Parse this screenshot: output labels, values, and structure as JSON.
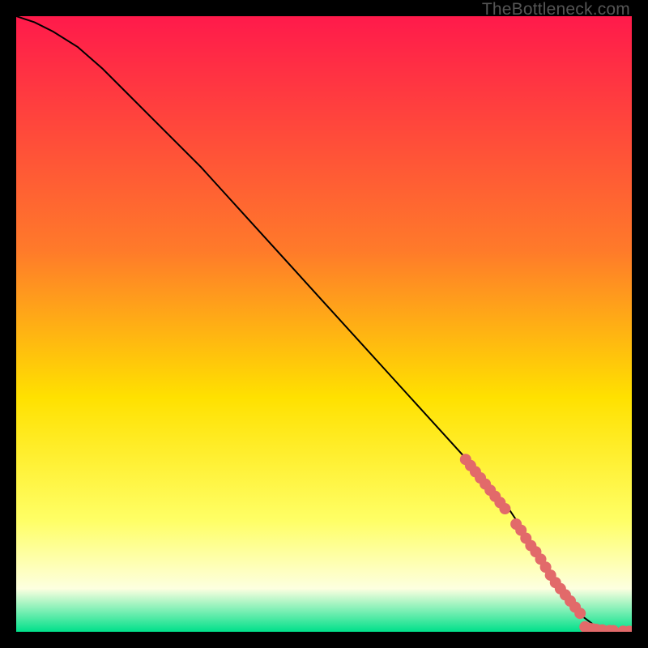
{
  "watermark": "TheBottleneck.com",
  "colors": {
    "gradient_top": "#ff1a4b",
    "gradient_mid1": "#ff7a2a",
    "gradient_mid2": "#ffe100",
    "gradient_mid3": "#ffff66",
    "gradient_mid4": "#fdffe0",
    "gradient_bottom": "#00e08a",
    "curve": "#000000",
    "marker": "#e26a6a",
    "frame": "#000000"
  },
  "chart_data": {
    "type": "line",
    "title": "",
    "xlabel": "",
    "ylabel": "",
    "xlim": [
      0,
      100
    ],
    "ylim": [
      0,
      100
    ],
    "series": [
      {
        "name": "curve",
        "x": [
          0,
          3,
          6,
          10,
          14,
          18,
          22,
          26,
          30,
          35,
          40,
          45,
          50,
          55,
          60,
          65,
          70,
          75,
          80,
          84,
          86,
          88,
          90,
          92,
          94,
          96,
          98,
          100
        ],
        "y": [
          100,
          99,
          97.5,
          95,
          91.5,
          87.5,
          83.5,
          79.5,
          75.5,
          70,
          64.5,
          59,
          53.5,
          48,
          42.5,
          37,
          31.5,
          26,
          20,
          14,
          11,
          8,
          5,
          2.5,
          1,
          0.3,
          0.1,
          0.05
        ]
      }
    ],
    "markers": [
      {
        "x": 73,
        "y": 28
      },
      {
        "x": 73.8,
        "y": 27
      },
      {
        "x": 74.6,
        "y": 26
      },
      {
        "x": 75.4,
        "y": 25
      },
      {
        "x": 76.2,
        "y": 24
      },
      {
        "x": 77,
        "y": 23
      },
      {
        "x": 77.8,
        "y": 22
      },
      {
        "x": 78.6,
        "y": 21
      },
      {
        "x": 79.4,
        "y": 20
      },
      {
        "x": 81.2,
        "y": 17.5
      },
      {
        "x": 82,
        "y": 16.5
      },
      {
        "x": 82.8,
        "y": 15.2
      },
      {
        "x": 83.6,
        "y": 14
      },
      {
        "x": 84.4,
        "y": 13
      },
      {
        "x": 85.2,
        "y": 11.8
      },
      {
        "x": 86,
        "y": 10.5
      },
      {
        "x": 86.8,
        "y": 9.2
      },
      {
        "x": 87.6,
        "y": 8
      },
      {
        "x": 88.4,
        "y": 7
      },
      {
        "x": 89.2,
        "y": 6
      },
      {
        "x": 90,
        "y": 5
      },
      {
        "x": 90.8,
        "y": 4
      },
      {
        "x": 91.6,
        "y": 3
      },
      {
        "x": 92.4,
        "y": 0.8
      },
      {
        "x": 93,
        "y": 0.6
      },
      {
        "x": 93.6,
        "y": 0.5
      },
      {
        "x": 94.2,
        "y": 0.4
      },
      {
        "x": 95.2,
        "y": 0.3
      },
      {
        "x": 96.4,
        "y": 0.2
      },
      {
        "x": 97,
        "y": 0.18
      },
      {
        "x": 98.6,
        "y": 0.1
      },
      {
        "x": 99.6,
        "y": 0.08
      }
    ]
  }
}
